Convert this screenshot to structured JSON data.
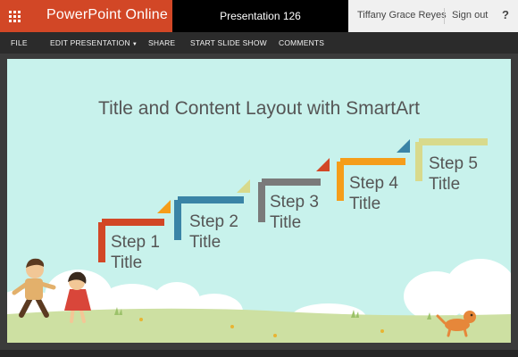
{
  "header": {
    "app_name": "PowerPoint Online",
    "document_title": "Presentation 126",
    "user_name": "Tiffany Grace Reyes",
    "sign_out_label": "Sign out",
    "help_label": "?"
  },
  "ribbon": {
    "file": "FILE",
    "edit_presentation": "EDIT PRESENTATION",
    "share": "SHARE",
    "start_slide_show": "START SLIDE SHOW",
    "comments": "COMMENTS"
  },
  "slide": {
    "title": "Title and Content Layout with SmartArt",
    "steps": [
      {
        "label": "Step 1",
        "sub": "Title",
        "color": "#d24726"
      },
      {
        "label": "Step 2",
        "sub": "Title",
        "color": "#3a84a6"
      },
      {
        "label": "Step 3",
        "sub": "Title",
        "color": "#7a7a7a"
      },
      {
        "label": "Step 4",
        "sub": "Title",
        "color": "#f59d1a"
      },
      {
        "label": "Step 5",
        "sub": "Title",
        "color": "#d8da8c"
      }
    ]
  },
  "colors": {
    "brand": "#d24726",
    "slide_background": "#c8f2ec",
    "grass": "#cde0a2"
  }
}
